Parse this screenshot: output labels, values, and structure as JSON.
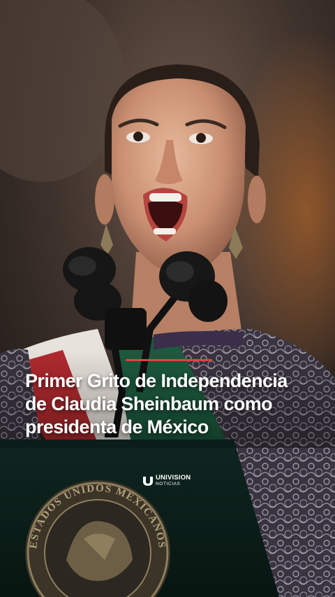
{
  "story": {
    "headline_lines": [
      "Primer Grito de Independencia",
      "de Claudia Sheinbaum como",
      "presidenta de México"
    ],
    "accent_color": "#e0443a"
  },
  "brand": {
    "name": "UNIVISION",
    "subtitle": "NOTICIAS"
  },
  "podium": {
    "seal_text": "ESTADOS UNIDOS MEXICANOS"
  }
}
